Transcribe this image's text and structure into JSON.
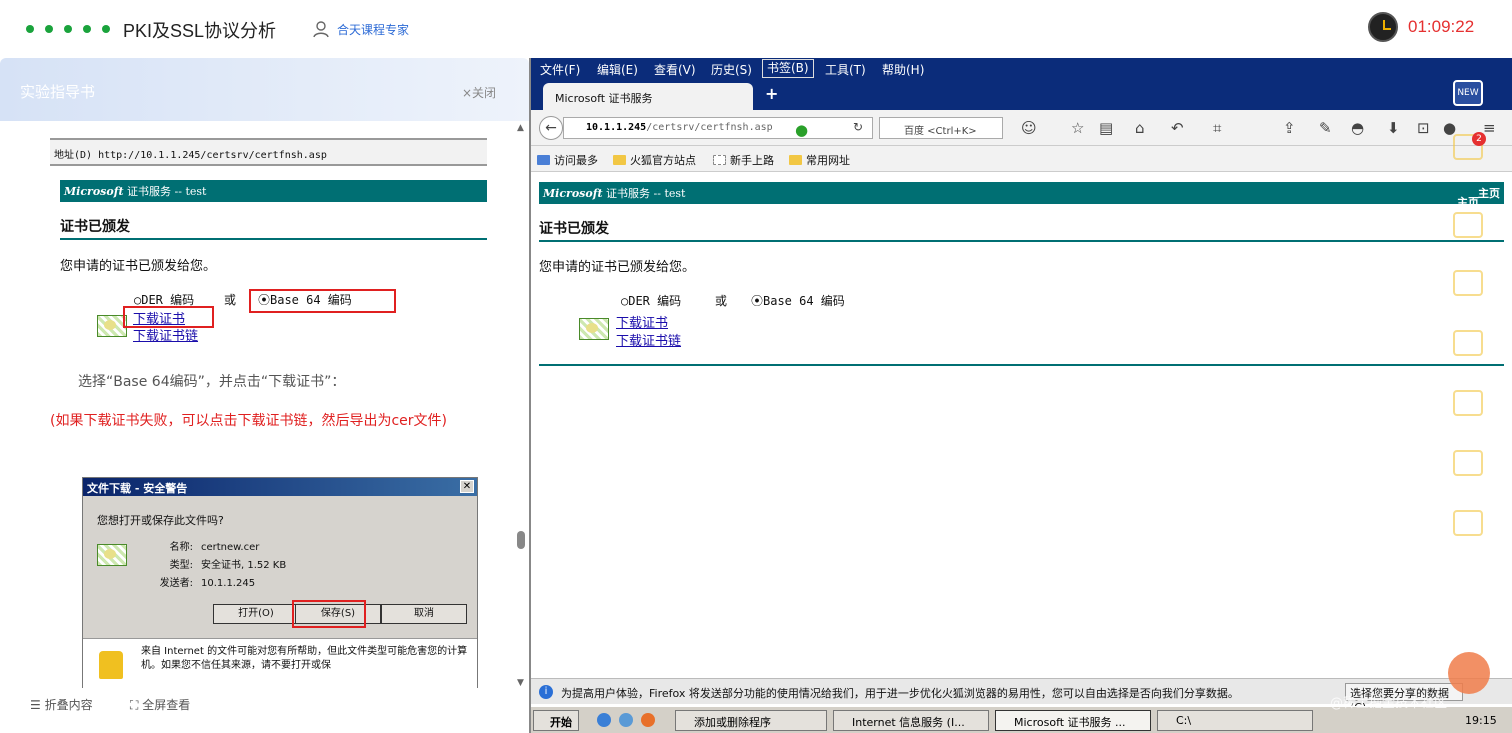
{
  "app": {
    "title": "PKI及SSL协议分析",
    "expert_label": "合天课程专家",
    "timer": "01:09:22"
  },
  "guide": {
    "title": "实验指导书",
    "close_label": "×关闭",
    "shot_address": "地址(D) http://10.1.1.245/certsrv/certfnsh.asp",
    "shot_ms_brand": "Microsoft",
    "shot_ms_rest": "证书服务 --  test",
    "shot_heading": "证书已颁发",
    "shot_para": "您申请的证书已颁发给您。",
    "shot_der": "○DER 编码",
    "shot_or": "或",
    "shot_base64": "⦿Base 64 编码",
    "shot_download": "下载证书",
    "shot_download_chain": "下载证书链",
    "instruction": "选择“Base 64编码”，并点击“下载证书”：",
    "warning": "(如果下载证书失败，可以点击下载证书链，然后导出为cer文件)",
    "dialog": {
      "title": "文件下载 - 安全警告",
      "question": "您想打开或保存此文件吗?",
      "name_key": "名称:",
      "name_val": "certnew.cer",
      "type_key": "类型:",
      "type_val": "安全证书, 1.52 KB",
      "from_key": "发送者:",
      "from_val": "10.1.1.245",
      "open": "打开(O)",
      "save": "保存(S)",
      "cancel": "取消",
      "warn_text": "来自 Internet 的文件可能对您有所帮助，但此文件类型可能危害您的计算机。如果您不信任其来源，请不要打开或保"
    },
    "footer": {
      "collapse": "☰ 折叠内容",
      "fullscreen": "⛶ 全屏查看"
    }
  },
  "browser": {
    "menu": [
      "文件(F)",
      "编辑(E)",
      "查看(V)",
      "历史(S)",
      "书签(B)",
      "工具(T)",
      "帮助(H)"
    ],
    "tab_title": "Microsoft 证书服务",
    "new_tab": "+",
    "url_host": "10.1.1.245",
    "url_path": "/certsrv/certfnsh.asp",
    "search_placeholder": "百度 <Ctrl+K>",
    "bookmarks": [
      "访问最多",
      "火狐官方站点",
      "新手上路",
      "常用网址"
    ],
    "page": {
      "ms_brand": "Microsoft",
      "ms_rest": "证书服务 --  test",
      "home": "主页",
      "heading": "证书已颁发",
      "para": "您申请的证书已颁发给您。",
      "der": "○DER 编码",
      "or": "或",
      "base64": "⦿Base 64 编码",
      "download": "下载证书",
      "download_chain": "下载证书链"
    },
    "notification": "为提高用户体验，Firefox 将发送部分功能的使用情况给我们，用于进一步优化火狐浏览器的易用性，您可以自由选择是否向我们分享数据。",
    "notification_choose": "选择您要分享的数据(C)",
    "taskbar": {
      "start": "开始",
      "tasks": [
        "添加或删除程序",
        "Internet 信息服务 (I...",
        "Microsoft 证书服务 ...",
        "C:\\"
      ],
      "time": "19:15"
    }
  },
  "right_tools": [
    "NEW",
    "2",
    "主页"
  ],
  "watermark": "@稀土掘金技术社区",
  "colors": {
    "ms_teal": "#006f73",
    "menu_blue": "#0b2c7a",
    "timer_red": "#e53030",
    "highlight_red": "#e02020"
  }
}
